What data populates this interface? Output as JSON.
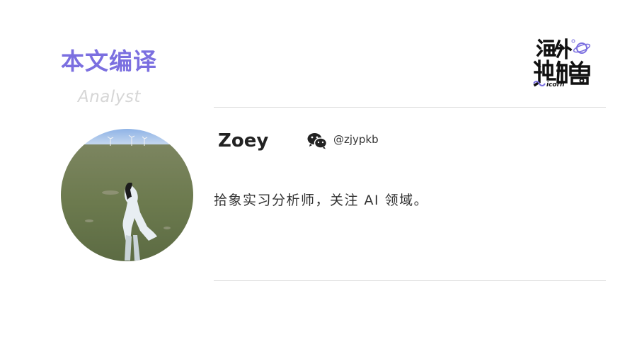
{
  "section": {
    "title": "本文编译",
    "subtitle": "Analyst"
  },
  "logo": {
    "icon": "haiwai-dujiaoshou-unicorn-logo",
    "text_cn": "海外独角兽",
    "text_en": "icorn"
  },
  "author": {
    "name": "Zoey",
    "social_icon": "wechat-icon",
    "handle": "@zjypkb",
    "bio": "拾象实习分析师，关注 AI 领域。"
  },
  "colors": {
    "accent": "#7b6fe0",
    "subtitle": "#d6d6d6",
    "divider": "#dcdcdc",
    "text": "#333333"
  }
}
